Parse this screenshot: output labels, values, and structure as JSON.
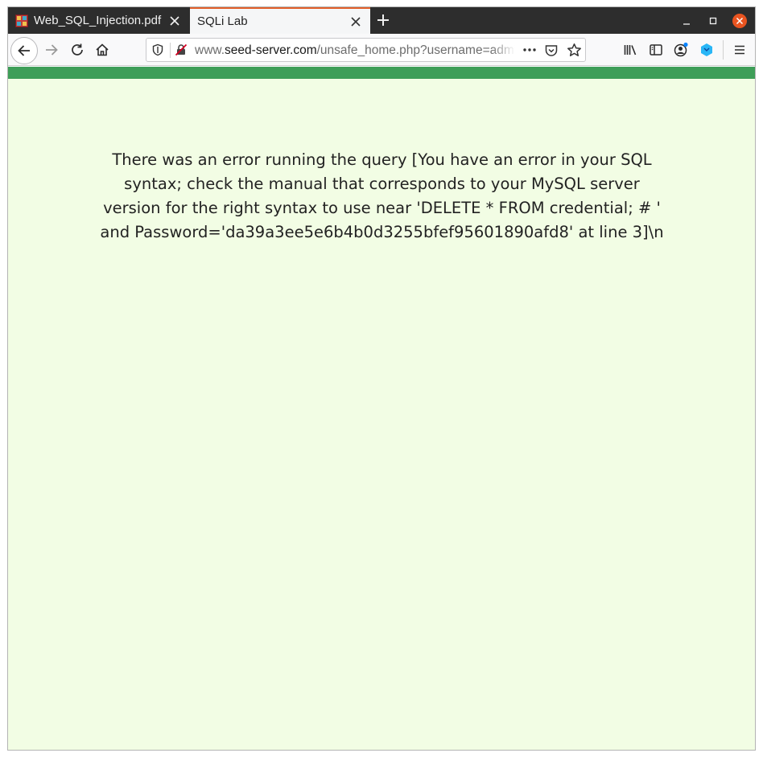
{
  "tabs": [
    {
      "title": "Web_SQL_Injection.pdf",
      "active": false
    },
    {
      "title": "SQLi Lab",
      "active": true
    }
  ],
  "url": {
    "prefix": "www.",
    "domain": "seed-server.com",
    "path": "/unsafe_home.php?username=admin"
  },
  "page": {
    "error_message": "There was an error running the query [You have an error in your SQL syntax; check the manual that corresponds to your MySQL server version for the right syntax to use near 'DELETE * FROM credential; # ' and Password='da39a3ee5e6b4b0d3255bfef95601890afd8' at line 3]\\n"
  },
  "colors": {
    "page_background": "#f2fde4",
    "header_bar": "#3e9e58",
    "active_tab_accent": "#e25f2a",
    "close_button": "#e95420"
  }
}
